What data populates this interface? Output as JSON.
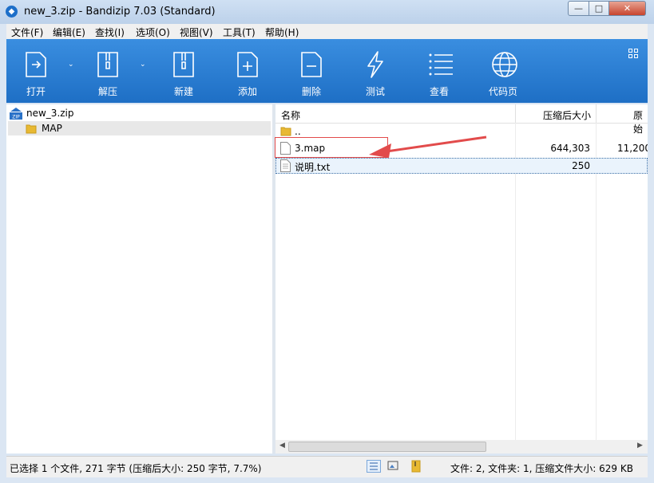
{
  "window": {
    "title": "new_3.zip - Bandizip 7.03 (Standard)"
  },
  "menu": [
    "文件(F)",
    "编辑(E)",
    "查找(I)",
    "选项(O)",
    "视图(V)",
    "工具(T)",
    "帮助(H)"
  ],
  "toolbar": {
    "open": "打开",
    "extract": "解压",
    "new": "新建",
    "add": "添加",
    "delete": "删除",
    "test": "测试",
    "view": "查看",
    "codepage": "代码页"
  },
  "tree": {
    "root": "new_3.zip",
    "child": "MAP"
  },
  "columns": {
    "name": "名称",
    "compressed": "压缩后大小",
    "original": "原始"
  },
  "files": [
    {
      "name": "..",
      "compressed": "",
      "original": ""
    },
    {
      "name": "3.map",
      "compressed": "644,303",
      "original": "11,200"
    },
    {
      "name": "说明.txt",
      "compressed": "250",
      "original": ""
    }
  ],
  "status": {
    "left": "已选择 1 个文件, 271 字节 (压缩后大小: 250 字节, 7.7%)",
    "right": "文件: 2, 文件夹: 1, 压缩文件大小: 629 KB"
  },
  "colors": {
    "toolbar_top": "#3a8ee0",
    "toolbar_bottom": "#1e6fc5",
    "annotation": "#e24b4b"
  }
}
